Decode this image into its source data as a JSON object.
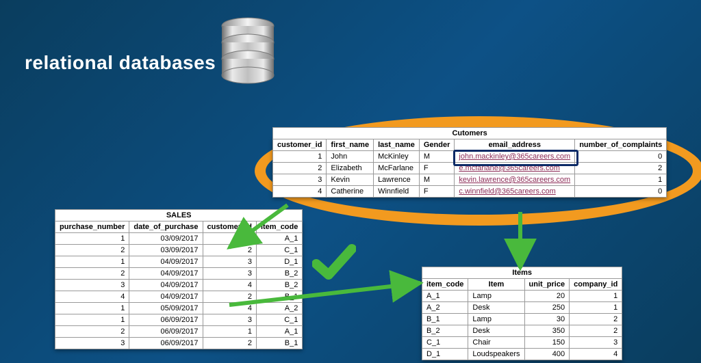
{
  "title": "relational databases",
  "tables": {
    "customers": {
      "caption": "Cutomers",
      "columns": [
        "customer_id",
        "first_name",
        "last_name",
        "Gender",
        "email_address",
        "number_of_complaints"
      ],
      "rows": [
        {
          "id": 1,
          "first": "John",
          "last": "McKinley",
          "gender": "M",
          "email": "john.mackinley@365careers.com",
          "complaints": 0
        },
        {
          "id": 2,
          "first": "Elizabeth",
          "last": "McFarlane",
          "gender": "F",
          "email": "e.mcfarlane@365careers.com",
          "complaints": 2
        },
        {
          "id": 3,
          "first": "Kevin",
          "last": "Lawrence",
          "gender": "M",
          "email": "kevin.lawrence@365careers.com",
          "complaints": 1
        },
        {
          "id": 4,
          "first": "Catherine",
          "last": "Winnfield",
          "gender": "F",
          "email": "c.winnfield@365careers.com",
          "complaints": 0
        }
      ]
    },
    "sales": {
      "caption": "SALES",
      "columns": [
        "purchase_number",
        "date_of_purchase",
        "customer_id",
        "item_code"
      ],
      "rows": [
        {
          "pn": 1,
          "date": "03/09/2017",
          "cid": 1,
          "item": "A_1"
        },
        {
          "pn": 2,
          "date": "03/09/2017",
          "cid": 2,
          "item": "C_1"
        },
        {
          "pn": 1,
          "date": "04/09/2017",
          "cid": 3,
          "item": "D_1"
        },
        {
          "pn": 2,
          "date": "04/09/2017",
          "cid": 3,
          "item": "B_2"
        },
        {
          "pn": 3,
          "date": "04/09/2017",
          "cid": 4,
          "item": "B_2"
        },
        {
          "pn": 4,
          "date": "04/09/2017",
          "cid": 2,
          "item": "B_1"
        },
        {
          "pn": 1,
          "date": "05/09/2017",
          "cid": 4,
          "item": "A_2"
        },
        {
          "pn": 1,
          "date": "06/09/2017",
          "cid": 3,
          "item": "C_1"
        },
        {
          "pn": 2,
          "date": "06/09/2017",
          "cid": 1,
          "item": "A_1"
        },
        {
          "pn": 3,
          "date": "06/09/2017",
          "cid": 2,
          "item": "B_1"
        }
      ]
    },
    "items": {
      "caption": "Items",
      "columns": [
        "item_code",
        "Item",
        "unit_price",
        "company_id"
      ],
      "rows": [
        {
          "code": "A_1",
          "item": "Lamp",
          "price": 20,
          "cid": 1
        },
        {
          "code": "A_2",
          "item": "Desk",
          "price": 250,
          "cid": 1
        },
        {
          "code": "B_1",
          "item": "Lamp",
          "price": 30,
          "cid": 2
        },
        {
          "code": "B_2",
          "item": "Desk",
          "price": 350,
          "cid": 2
        },
        {
          "code": "C_1",
          "item": "Chair",
          "price": 150,
          "cid": 3
        },
        {
          "code": "D_1",
          "item": "Loudspeakers",
          "price": 400,
          "cid": 4
        }
      ]
    }
  },
  "highlight_color": "#f29a1f",
  "arrow_color": "#49b93c"
}
